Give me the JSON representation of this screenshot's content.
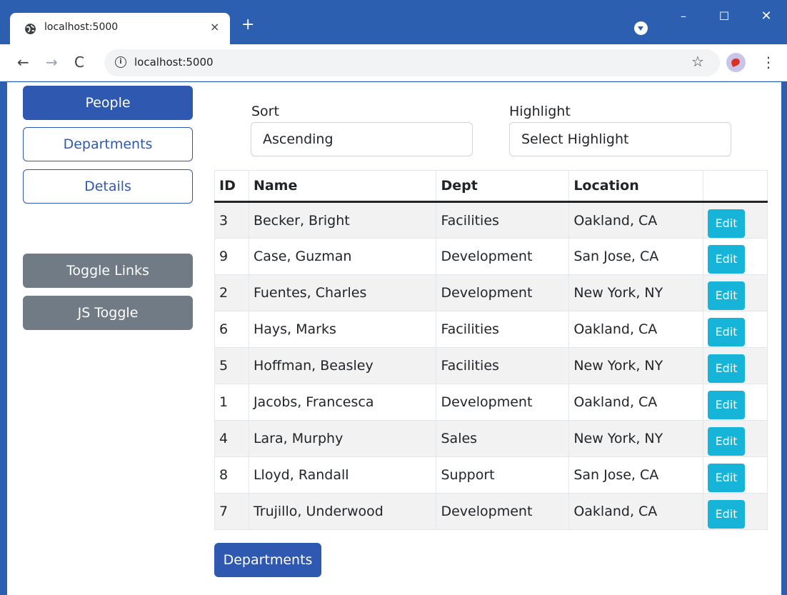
{
  "browser": {
    "tab_title": "localhost:5000",
    "tab_close": "×",
    "new_tab": "+",
    "url": "localhost:5000",
    "window_minimize": "–",
    "window_maximize": "☐",
    "window_close": "✕",
    "info_glyph": "i",
    "back_glyph": "←",
    "forward_glyph": "→",
    "reload_glyph": "C",
    "star_glyph": "☆",
    "menu_glyph": "⋮"
  },
  "sidebar": {
    "items": [
      {
        "label": "People"
      },
      {
        "label": "Departments"
      },
      {
        "label": "Details"
      }
    ],
    "toggle_links": "Toggle Links",
    "js_toggle": "JS Toggle"
  },
  "controls": {
    "sort_label": "Sort",
    "sort_value": "Ascending",
    "highlight_label": "Highlight",
    "highlight_value": "Select Highlight"
  },
  "table": {
    "headers": [
      "ID",
      "Name",
      "Dept",
      "Location",
      ""
    ],
    "edit_label": "Edit",
    "rows": [
      {
        "id": "3",
        "name": "Becker, Bright",
        "dept": "Facilities",
        "location": "Oakland, CA"
      },
      {
        "id": "9",
        "name": "Case, Guzman",
        "dept": "Development",
        "location": "San Jose, CA"
      },
      {
        "id": "2",
        "name": "Fuentes, Charles",
        "dept": "Development",
        "location": "New York, NY"
      },
      {
        "id": "6",
        "name": "Hays, Marks",
        "dept": "Facilities",
        "location": "Oakland, CA"
      },
      {
        "id": "5",
        "name": "Hoffman, Beasley",
        "dept": "Facilities",
        "location": "New York, NY"
      },
      {
        "id": "1",
        "name": "Jacobs, Francesca",
        "dept": "Development",
        "location": "Oakland, CA"
      },
      {
        "id": "4",
        "name": "Lara, Murphy",
        "dept": "Sales",
        "location": "New York, NY"
      },
      {
        "id": "8",
        "name": "Lloyd, Randall",
        "dept": "Support",
        "location": "San Jose, CA"
      },
      {
        "id": "7",
        "name": "Trujillo, Underwood",
        "dept": "Development",
        "location": "Oakland, CA"
      }
    ]
  },
  "footer_button": "Departments",
  "colors": {
    "chrome": "#2c5fb0",
    "primary": "#2f59b0",
    "secondary": "#717b86",
    "info": "#16b4d9"
  }
}
